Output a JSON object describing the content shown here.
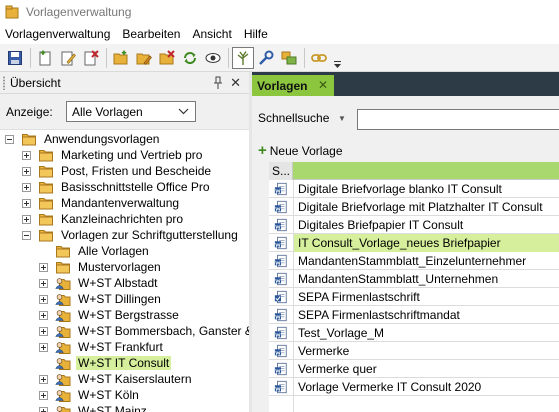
{
  "window": {
    "title": "Vorlagenverwaltung"
  },
  "menu": [
    "Vorlagenverwaltung",
    "Bearbeiten",
    "Ansicht",
    "Hilfe"
  ],
  "toolbar": {
    "buttons": [
      "save-icon",
      "new-template-icon",
      "edit-icon",
      "delete-icon",
      "new-folder-icon",
      "folder-edit-icon",
      "folder-delete-icon",
      "refresh-icon",
      "preview-icon",
      "tree-icon",
      "settings-wrench-icon",
      "layout-icon",
      "link-icon"
    ],
    "active": "tree-icon"
  },
  "left_panel": {
    "title": "Übersicht",
    "filter_label": "Anzeige:",
    "filter_value": "Alle Vorlagen",
    "tree": [
      {
        "label": "Anwendungsvorlagen",
        "level": 0,
        "expander": "minus",
        "icon": "folder"
      },
      {
        "label": "Marketing und Vertrieb pro",
        "level": 1,
        "expander": "plus",
        "icon": "folder"
      },
      {
        "label": "Post, Fristen und Bescheide",
        "level": 1,
        "expander": "plus",
        "icon": "folder"
      },
      {
        "label": "Basisschnittstelle Office Pro",
        "level": 1,
        "expander": "plus",
        "icon": "folder"
      },
      {
        "label": "Mandantenverwaltung",
        "level": 1,
        "expander": "plus",
        "icon": "folder"
      },
      {
        "label": "Kanzleinachrichten pro",
        "level": 1,
        "expander": "plus",
        "icon": "folder"
      },
      {
        "label": "Vorlagen zur Schriftgutterstellung",
        "level": 1,
        "expander": "minus",
        "icon": "folder"
      },
      {
        "label": "Alle Vorlagen",
        "level": 2,
        "expander": "none",
        "icon": "folder"
      },
      {
        "label": "Mustervorlagen",
        "level": 2,
        "expander": "plus",
        "icon": "folder"
      },
      {
        "label": "W+ST Albstadt",
        "level": 2,
        "expander": "plus",
        "icon": "user-folder"
      },
      {
        "label": "W+ST Dillingen",
        "level": 2,
        "expander": "plus",
        "icon": "user-folder"
      },
      {
        "label": "W+ST Bergstrasse",
        "level": 2,
        "expander": "plus",
        "icon": "user-folder"
      },
      {
        "label": "W+ST Bommersbach, Ganster & ...",
        "level": 2,
        "expander": "plus",
        "icon": "user-folder"
      },
      {
        "label": "W+ST Frankfurt",
        "level": 2,
        "expander": "plus",
        "icon": "user-folder"
      },
      {
        "label": "W+ST IT Consult",
        "level": 2,
        "expander": "none",
        "icon": "user-folder",
        "selected": true
      },
      {
        "label": "W+ST Kaiserslautern",
        "level": 2,
        "expander": "plus",
        "icon": "user-folder"
      },
      {
        "label": "W+ST Köln",
        "level": 2,
        "expander": "plus",
        "icon": "user-folder"
      },
      {
        "label": "W+ST Mainz",
        "level": 2,
        "expander": "plus",
        "icon": "user-folder"
      }
    ]
  },
  "right_panel": {
    "tab_label": "Vorlagen",
    "quicksearch_label": "Schnellsuche",
    "quicksearch_value": "",
    "new_button": "Neue Vorlage",
    "column_header": "S...",
    "rows": [
      {
        "name": "Digitale Briefvorlage blanko IT Consult",
        "icon": "word-doc"
      },
      {
        "name": "Digitale Briefvorlage mit Platzhalter IT Consult",
        "icon": "word-doc"
      },
      {
        "name": "Digitales Briefpapier IT Consult",
        "icon": "word-doc"
      },
      {
        "name": "IT Consult_Vorlage_neues Briefpapier",
        "icon": "word-doc",
        "selected": true
      },
      {
        "name": "MandantenStammblatt_Einzelunternehmer",
        "icon": "word-doc"
      },
      {
        "name": "MandantenStammblatt_Unternehmen",
        "icon": "word-doc"
      },
      {
        "name": "SEPA Firmenlastschrift",
        "icon": "word-doc-check"
      },
      {
        "name": "SEPA Firmenlastschriftmandat",
        "icon": "word-doc"
      },
      {
        "name": "Test_Vorlage_M",
        "icon": "word-doc"
      },
      {
        "name": "Vermerke",
        "icon": "word-doc"
      },
      {
        "name": "Vermerke quer",
        "icon": "word-doc"
      },
      {
        "name": "Vorlage Vermerke IT Consult 2020",
        "icon": "word-doc"
      }
    ]
  },
  "colors": {
    "accent_green": "#8cc63f",
    "selection": "#d6ef9c",
    "tab_strip": "#2c3b45",
    "folder_yellow": "#e8b23a"
  }
}
